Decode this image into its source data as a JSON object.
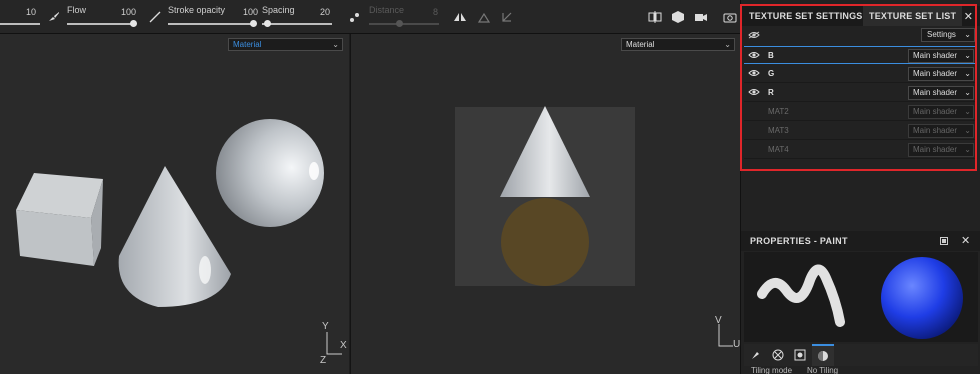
{
  "toolbar": {
    "size_value": "10",
    "flow_label": "Flow",
    "flow_value": "100",
    "stroke_opacity_label": "Stroke opacity",
    "stroke_opacity_value": "100",
    "spacing_label": "Spacing",
    "spacing_value": "20",
    "distance_label": "Distance",
    "distance_value": "8"
  },
  "viewport_left": {
    "channel": "Material",
    "axes": {
      "y": "Y",
      "x": "X",
      "z": "Z"
    }
  },
  "viewport_right": {
    "channel": "Material",
    "axes": {
      "v": "V",
      "u": "U"
    }
  },
  "panel": {
    "tab_settings": "TEXTURE SET SETTINGS",
    "tab_list": "TEXTURE SET LIST",
    "close": "✕",
    "settings_button": "Settings",
    "texture_sets": [
      {
        "name": "B",
        "shader": "Main shader",
        "visible": true,
        "enabled": true
      },
      {
        "name": "G",
        "shader": "Main shader",
        "visible": true,
        "enabled": true
      },
      {
        "name": "R",
        "shader": "Main shader",
        "visible": true,
        "enabled": true
      },
      {
        "name": "MAT2",
        "shader": "Main shader",
        "visible": false,
        "enabled": false
      },
      {
        "name": "MAT3",
        "shader": "Main shader",
        "visible": false,
        "enabled": false
      },
      {
        "name": "MAT4",
        "shader": "Main shader",
        "visible": false,
        "enabled": false
      }
    ],
    "properties_title": "PROPERTIES - PAINT",
    "tiling_mode_label": "Tiling mode",
    "tiling_mode_value": "No Tiling"
  },
  "colors": {
    "accent": "#3b8ee0",
    "highlight": "#e0262a",
    "sphere": "#1f3de6"
  }
}
